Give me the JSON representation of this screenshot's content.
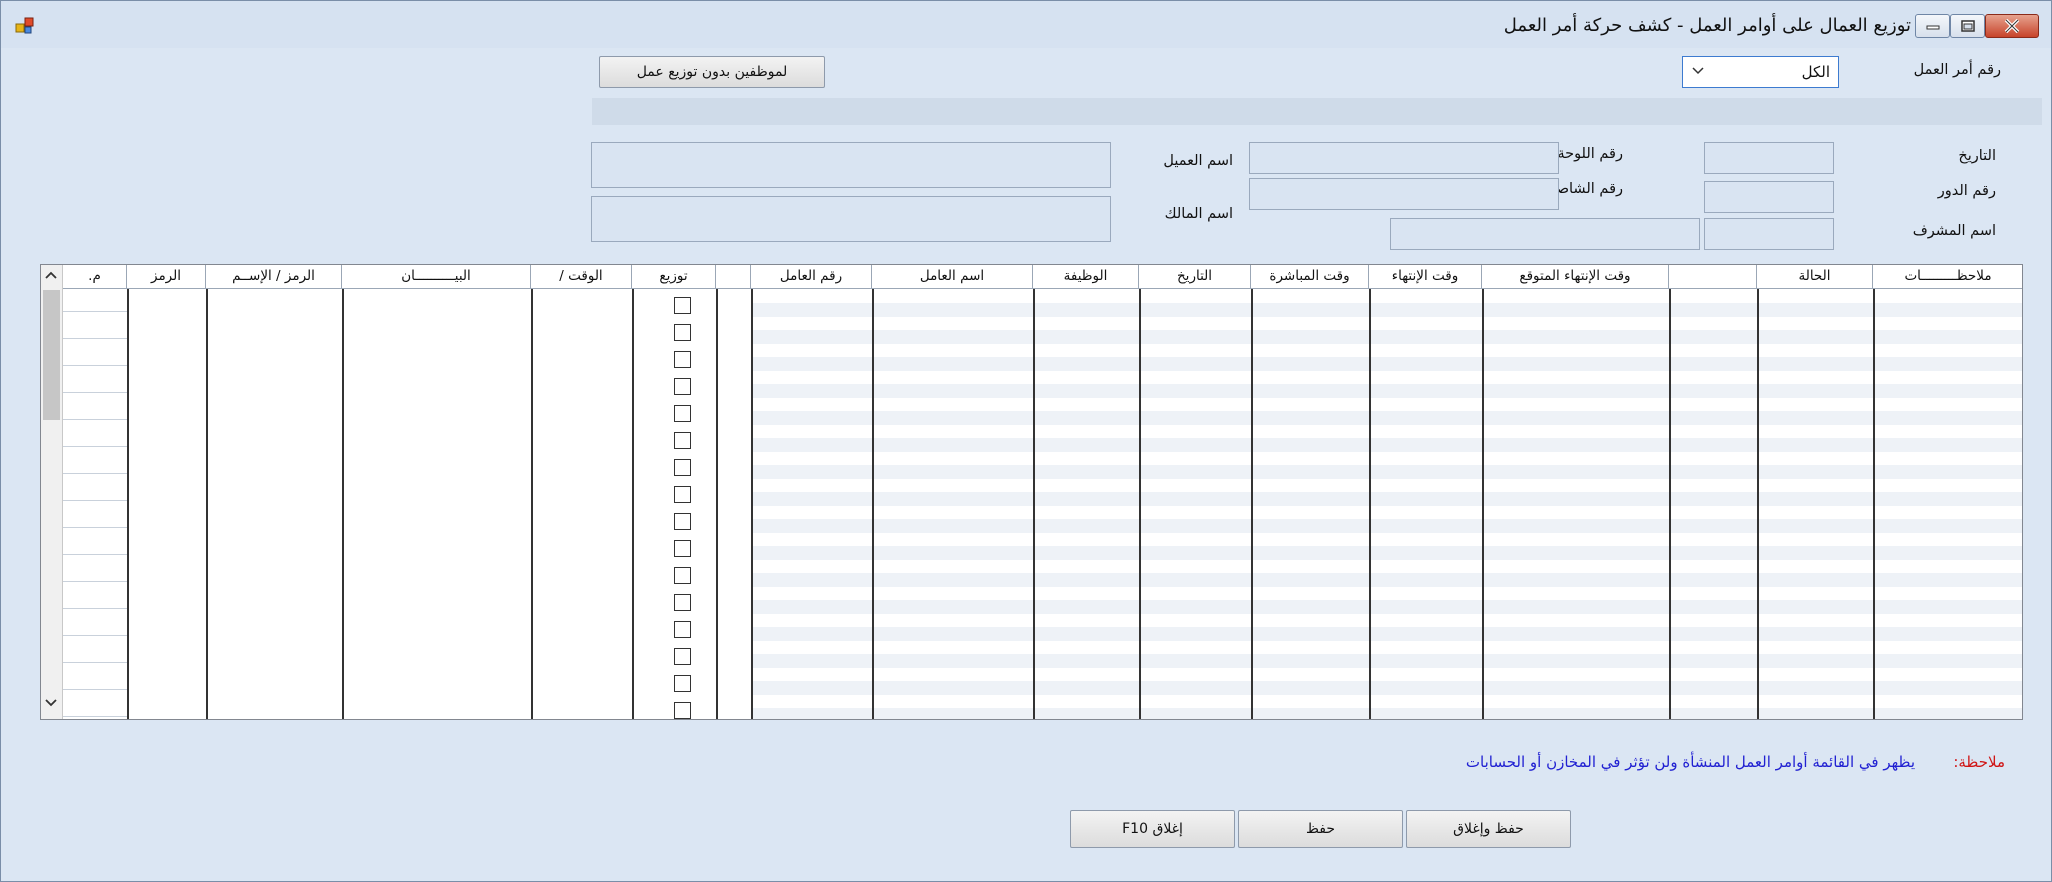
{
  "window": {
    "title": "توزيع العمال على أوامر العمل - كشف حركة أمر العمل"
  },
  "header": {
    "work_order_label": "رقم أمر العمل",
    "work_order_value": "الكل",
    "no_dist_button": "لموظفين بدون توزيع عمل"
  },
  "fields": {
    "date_label": "التاريخ",
    "plate_label": "رقم اللوحة",
    "customer_label": "اسم العميل",
    "turn_label": "رقم الدور",
    "chassis_label": "رقم الشاصي",
    "owner_label": "اسم المالك",
    "supervisor_label": "اسم المشرف"
  },
  "grid": {
    "right_headers": [
      "ملاحظـــــــــات",
      "الحالة",
      "",
      "وقت الإنتهاء المتوقع",
      "وقت الإنتهاء",
      "وقت المباشرة",
      "التاريخ",
      "الوظيفة",
      "اسم العامل",
      "رقم العامل",
      ""
    ],
    "left_headers": [
      "توزيع",
      "الوقت /",
      "البيــــــــــان",
      "الرمز / الإســم",
      "الرمز",
      "م."
    ]
  },
  "note": {
    "label": "ملاحظة:",
    "text": "يظهر في القائمة أوامر العمل المنشأة ولن تؤثر في المخازن أو الحسابات"
  },
  "footer": {
    "close_button": "إغلاق F10",
    "save_button": "حفظ",
    "save_close_button": "حفظ وإغلاق"
  }
}
